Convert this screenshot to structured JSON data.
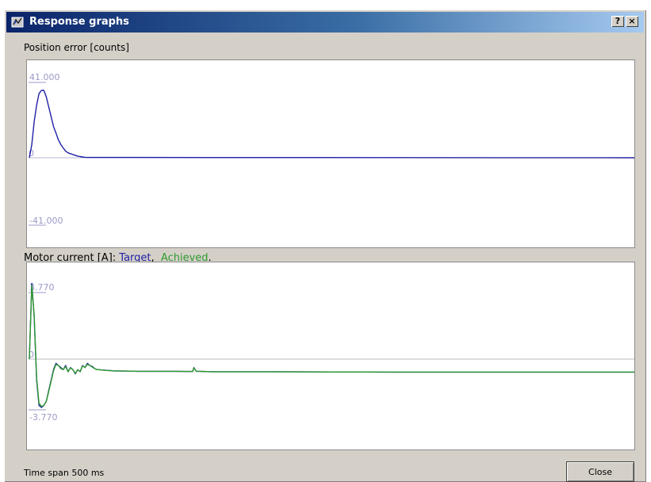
{
  "window": {
    "title": "Response graphs",
    "help_button": "?",
    "close_x_button": "×"
  },
  "colors": {
    "title_gradient_start": "#0a246a",
    "title_gradient_end": "#a6caf0",
    "position_trace": "#2121a8",
    "target_trace": "#2121a8",
    "achieved_trace": "#2e9a2e",
    "axis_label": "#9a9ac8"
  },
  "position_graph": {
    "label": "Position error [counts]",
    "ymax_label": "41.000",
    "zero_label": "0",
    "ymin_label": "-41.000"
  },
  "motor_graph": {
    "label_prefix": "Motor current [A]: ",
    "target_label": "Target",
    "separator": ",  ",
    "achieved_label": "Achieved",
    "suffix": ".",
    "ymax_label": "3.770",
    "zero_label": "0",
    "ymin_label": "-3.770"
  },
  "chart_data": [
    {
      "type": "line",
      "title": "Position error [counts]",
      "xlim": [
        0,
        500
      ],
      "ylim": [
        -41,
        41
      ],
      "x_unit": "ms",
      "series": [
        {
          "x": [
            0,
            2,
            4,
            6,
            8,
            10,
            12,
            14,
            16,
            18,
            20,
            22,
            24,
            26,
            28,
            30,
            32,
            34,
            36,
            38,
            40,
            42,
            44,
            46,
            48,
            50,
            90,
            500
          ],
          "y": [
            0,
            8,
            22,
            32,
            39,
            41,
            41,
            37,
            31,
            25,
            19,
            15,
            11,
            8,
            6,
            4,
            3,
            2.5,
            2,
            1.5,
            1,
            0.7,
            0.5,
            0.3,
            0.2,
            0.2,
            0.2,
            0
          ]
        }
      ]
    },
    {
      "type": "line",
      "title": "Motor current [A]",
      "xlim": [
        0,
        500
      ],
      "ylim": [
        -3.77,
        3.77
      ],
      "x_unit": "ms",
      "series": [
        {
          "name": "Target",
          "x": [
            0,
            2,
            4,
            6,
            8,
            10,
            12,
            14,
            16,
            18,
            20,
            22,
            24,
            26,
            28,
            30,
            32,
            34,
            36,
            38,
            40,
            42,
            44,
            46,
            48,
            50,
            52,
            54,
            56,
            58,
            60,
            62,
            64,
            66,
            68,
            70,
            72,
            80,
            90,
            100,
            110,
            120,
            130,
            135,
            136,
            137,
            138,
            140,
            150,
            200,
            300,
            400,
            500
          ],
          "y": [
            0,
            3.6,
            2.0,
            -1.0,
            -2.2,
            -2.3,
            -2.2,
            -2.0,
            -1.5,
            -1.0,
            -0.5,
            -0.2,
            -0.3,
            -0.4,
            -0.5,
            -0.3,
            -0.6,
            -0.4,
            -0.5,
            -0.7,
            -0.5,
            -0.6,
            -0.3,
            -0.4,
            -0.2,
            -0.3,
            -0.35,
            -0.45,
            -0.5,
            -0.5,
            -0.52,
            -0.52,
            -0.54,
            -0.54,
            -0.55,
            -0.56,
            -0.56,
            -0.57,
            -0.58,
            -0.58,
            -0.58,
            -0.58,
            -0.59,
            -0.59,
            -0.4,
            -0.5,
            -0.58,
            -0.58,
            -0.6,
            -0.6,
            -0.62,
            -0.62,
            -0.62
          ]
        },
        {
          "name": "Achieved",
          "x": [
            0,
            2,
            4,
            6,
            8,
            10,
            12,
            14,
            16,
            18,
            20,
            22,
            24,
            26,
            28,
            30,
            32,
            34,
            36,
            38,
            40,
            42,
            44,
            46,
            48,
            50,
            52,
            54,
            56,
            58,
            60,
            62,
            64,
            66,
            68,
            70,
            72,
            80,
            90,
            100,
            110,
            120,
            130,
            135,
            136,
            137,
            138,
            140,
            150,
            200,
            300,
            400,
            500
          ],
          "y": [
            0,
            3.5,
            2.1,
            -0.9,
            -2.1,
            -2.25,
            -2.2,
            -2.0,
            -1.55,
            -1.05,
            -0.55,
            -0.25,
            -0.3,
            -0.45,
            -0.5,
            -0.35,
            -0.6,
            -0.42,
            -0.5,
            -0.68,
            -0.5,
            -0.6,
            -0.32,
            -0.4,
            -0.25,
            -0.3,
            -0.38,
            -0.45,
            -0.5,
            -0.5,
            -0.52,
            -0.53,
            -0.54,
            -0.55,
            -0.55,
            -0.56,
            -0.56,
            -0.57,
            -0.58,
            -0.58,
            -0.58,
            -0.58,
            -0.59,
            -0.59,
            -0.42,
            -0.5,
            -0.58,
            -0.58,
            -0.6,
            -0.6,
            -0.62,
            -0.62,
            -0.62
          ]
        }
      ]
    }
  ],
  "footer": {
    "time_span": "Time span 500 ms",
    "close_label": "Close"
  }
}
